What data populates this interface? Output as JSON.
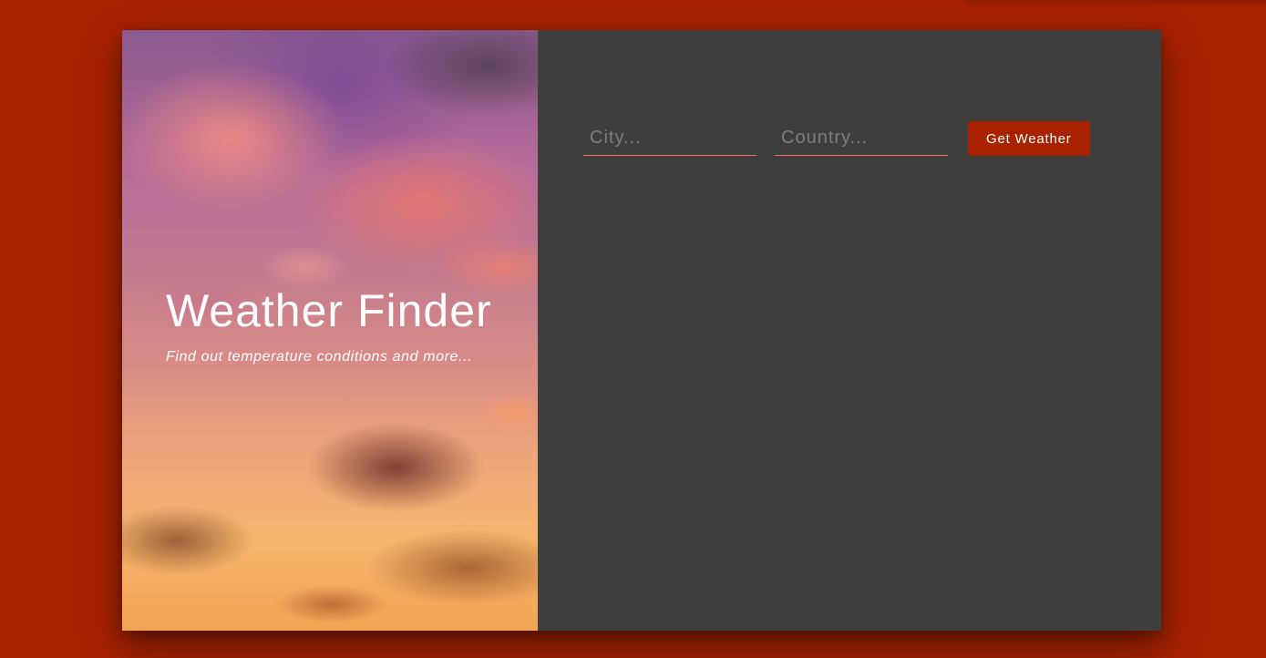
{
  "app": {
    "title": "Weather Finder",
    "subtitle": "Find out temperature conditions and more..."
  },
  "form": {
    "city": {
      "value": "",
      "placeholder": "City..."
    },
    "country": {
      "value": "",
      "placeholder": "Country..."
    },
    "submit_label": "Get Weather"
  },
  "colors": {
    "background": "#a82200",
    "panel": "#3e3e3e",
    "accent": "#a82200",
    "input_underline": "#f26a5a"
  },
  "hero": {
    "image": "sunset-clouds-sky"
  }
}
